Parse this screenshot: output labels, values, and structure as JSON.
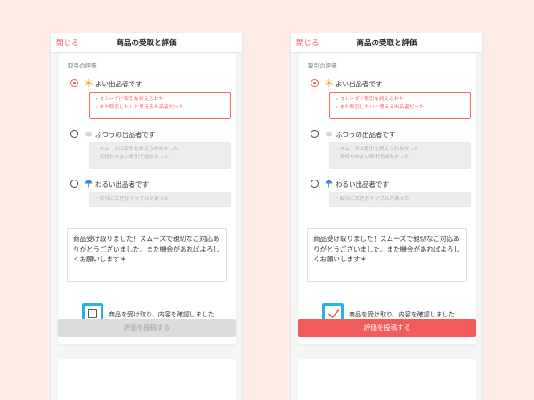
{
  "colors": {
    "accent": "#f05a5a",
    "highlight": "#2bb3e8",
    "page_background": "#fcece4"
  },
  "screens": [
    {
      "id": "left",
      "checked": false,
      "submit_enabled": false
    },
    {
      "id": "right",
      "checked": true,
      "submit_enabled": true
    }
  ],
  "header": {
    "close_label": "閉じる",
    "title": "商品の受取と評価"
  },
  "rating": {
    "section_label": "取引の評価",
    "options": [
      {
        "label": "よい出品者です",
        "icon": "sun-icon",
        "selected": true,
        "hints": [
          "・スムーズに取引を終えられた",
          "・また取引したいと思える出品者だった"
        ]
      },
      {
        "label": "ふつうの出品者です",
        "icon": "cloud-icon",
        "selected": false,
        "hints": [
          "・スムーズに取引を終えられなかった",
          "・気持ちのよい取引ではなかった"
        ]
      },
      {
        "label": "わるい出品者です",
        "icon": "umbrella-icon",
        "selected": false,
        "hints": [
          "・取引に大きなトラブルがあった"
        ]
      }
    ]
  },
  "comment": {
    "text": "商品受け取りました！スムーズで親切なご対応ありがとうございました。また機会があればよろしくお願いします＊"
  },
  "confirm": {
    "label": "商品を受け取り、内容を確認しました"
  },
  "submit": {
    "label": "評価を投稿する"
  }
}
